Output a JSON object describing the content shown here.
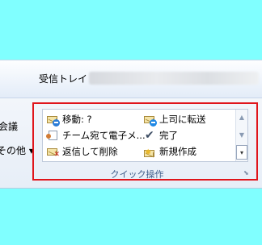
{
  "header": {
    "inbox_title": "受信トレイ"
  },
  "left_panel": {
    "label_1": "会議",
    "label_2": "その他 ▾"
  },
  "quick_steps": {
    "group_label": "クイック操作",
    "items": [
      {
        "label": "移動: ?",
        "icon": "move-envelope-icon"
      },
      {
        "label": "上司に転送",
        "icon": "forward-to-manager-icon"
      },
      {
        "label": "チーム宛て電子メ...",
        "icon": "team-email-icon"
      },
      {
        "label": "完了",
        "icon": "done-check-icon"
      },
      {
        "label": "返信して削除",
        "icon": "reply-delete-icon"
      },
      {
        "label": "新規作成",
        "icon": "create-new-icon"
      }
    ],
    "scroll": {
      "up": "▲",
      "down": "▼",
      "more": "▾"
    },
    "launcher": "⬊"
  },
  "colors": {
    "background": "#80ffff",
    "highlight_border": "#e0151b",
    "group_label": "#3f5d8a"
  }
}
